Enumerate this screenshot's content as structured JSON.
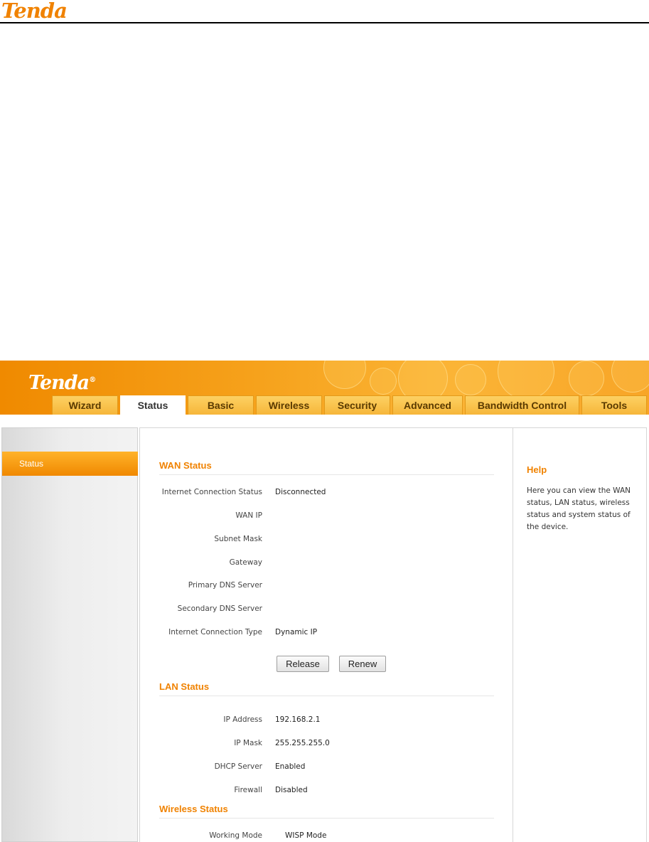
{
  "doc_header": {
    "logo": "Tenda"
  },
  "ui": {
    "logo": "Tenda",
    "tabs": [
      {
        "label": "Wizard"
      },
      {
        "label": "Status",
        "active": true
      },
      {
        "label": "Basic"
      },
      {
        "label": "Wireless"
      },
      {
        "label": "Security"
      },
      {
        "label": "Advanced"
      },
      {
        "label": "Bandwidth Control"
      },
      {
        "label": "Tools"
      }
    ],
    "sidebar": {
      "items": [
        {
          "label": "Status",
          "active": true
        }
      ]
    },
    "wan": {
      "title": "WAN Status",
      "rows": [
        {
          "label": "Internet Connection Status",
          "value": "Disconnected"
        },
        {
          "label": "WAN IP",
          "value": ""
        },
        {
          "label": "Subnet Mask",
          "value": ""
        },
        {
          "label": "Gateway",
          "value": ""
        },
        {
          "label": "Primary DNS Server",
          "value": ""
        },
        {
          "label": "Secondary DNS Server",
          "value": ""
        },
        {
          "label": "Internet Connection Type",
          "value": "Dynamic IP"
        }
      ],
      "buttons": {
        "release": "Release",
        "renew": "Renew"
      }
    },
    "lan": {
      "title": "LAN Status",
      "rows": [
        {
          "label": "IP Address",
          "value": "192.168.2.1"
        },
        {
          "label": "IP Mask",
          "value": "255.255.255.0"
        },
        {
          "label": "DHCP Server",
          "value": "Enabled"
        },
        {
          "label": "Firewall",
          "value": "Disabled"
        }
      ]
    },
    "wireless": {
      "title": "Wireless Status",
      "rows": [
        {
          "label": "Working Mode",
          "value": "WISP Mode"
        }
      ]
    },
    "help": {
      "title": "Help",
      "text": "Here you can view the WAN status, LAN status, wireless status and system status of the device."
    },
    "colors": {
      "accent": "#f08200",
      "header": "#f6a21c",
      "tab": "#fbc34a"
    }
  }
}
